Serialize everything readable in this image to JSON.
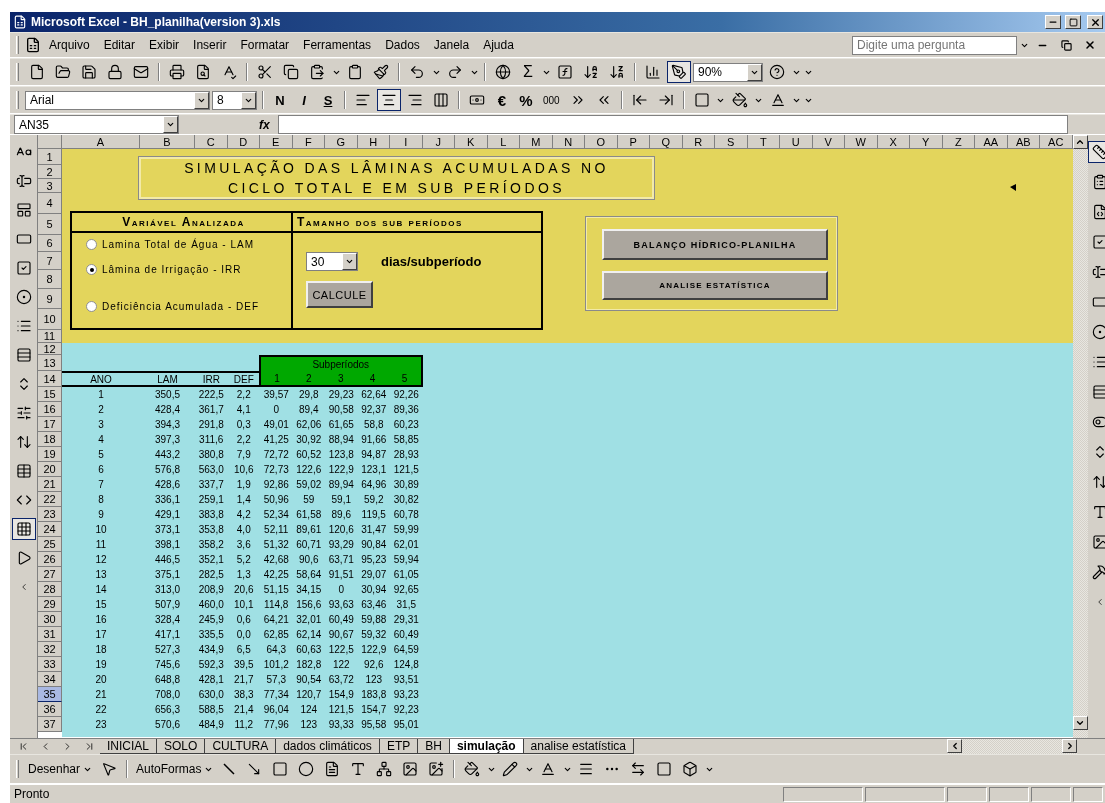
{
  "window": {
    "title": "Microsoft Excel - BH_planilha(version 3).xls"
  },
  "menu": [
    "Arquivo",
    "Editar",
    "Exibir",
    "Inserir",
    "Formatar",
    "Ferramentas",
    "Dados",
    "Janela",
    "Ajuda"
  ],
  "help_box": {
    "placeholder": "Digite uma pergunta"
  },
  "standard_toolbar": {
    "sum": "Σ",
    "zoom": "90%",
    "drawing_pressed": true
  },
  "formatting_toolbar": {
    "font": "Arial",
    "size": "8",
    "bold": "N",
    "italic": "I",
    "underline": "S",
    "align_left": false,
    "align_center": true,
    "align_right": false,
    "euro": "€",
    "percent": "%",
    "thousands": "000"
  },
  "formula_bar": {
    "name_box": "AN35",
    "function_label": "fx"
  },
  "forms_toolbar": {
    "grid_pressed": true
  },
  "control_toolbox": {
    "design_mode": true
  },
  "columns": [
    "A",
    "B",
    "C",
    "D",
    "E",
    "F",
    "G",
    "H",
    "I",
    "J",
    "K",
    "L",
    "M",
    "N",
    "O",
    "P",
    "Q",
    "R",
    "S",
    "T",
    "U",
    "V",
    "W",
    "X",
    "Y",
    "Z",
    "AA",
    "AB",
    "AC"
  ],
  "rows": [
    {
      "label": "1",
      "selected": false
    },
    {
      "label": "2",
      "selected": false
    },
    {
      "label": "3",
      "selected": false
    },
    {
      "label": "4",
      "selected": false
    },
    {
      "label": "5",
      "selected": false
    },
    {
      "label": "6",
      "selected": false
    },
    {
      "label": "7",
      "selected": false
    },
    {
      "label": "8",
      "selected": false
    },
    {
      "label": "9",
      "selected": false
    },
    {
      "label": "10",
      "selected": false
    },
    {
      "label": "11",
      "selected": false
    },
    {
      "label": "12",
      "selected": false
    },
    {
      "label": "13",
      "selected": false
    },
    {
      "label": "14",
      "selected": false
    },
    {
      "label": "15",
      "selected": false
    },
    {
      "label": "16",
      "selected": false
    },
    {
      "label": "17",
      "selected": false
    },
    {
      "label": "18",
      "selected": false
    },
    {
      "label": "19",
      "selected": false
    },
    {
      "label": "20",
      "selected": false
    },
    {
      "label": "21",
      "selected": false
    },
    {
      "label": "22",
      "selected": false
    },
    {
      "label": "23",
      "selected": false
    },
    {
      "label": "24",
      "selected": false
    },
    {
      "label": "25",
      "selected": false
    },
    {
      "label": "26",
      "selected": false
    },
    {
      "label": "27",
      "selected": false
    },
    {
      "label": "28",
      "selected": false
    },
    {
      "label": "29",
      "selected": false
    },
    {
      "label": "30",
      "selected": false
    },
    {
      "label": "31",
      "selected": false
    },
    {
      "label": "32",
      "selected": false
    },
    {
      "label": "33",
      "selected": false
    },
    {
      "label": "34",
      "selected": false
    },
    {
      "label": "35",
      "selected": true
    },
    {
      "label": "36",
      "selected": false
    },
    {
      "label": "37",
      "selected": false
    }
  ],
  "sheet": {
    "title": [
      "SIMULAÇÃO DAS LÂMINAS ACUMULADAS NO",
      "CICLO TOTAL E EM SUB PERÍODOS"
    ],
    "variable_panel": {
      "heading": "Variável Analizada",
      "options": [
        {
          "label": "Lamina Total de Água - LAM",
          "selected": false
        },
        {
          "label": "Lâmina de Irrigação - IRR",
          "selected": true
        },
        {
          "label": "Deficiência Acumulada - DEF",
          "selected": false
        }
      ]
    },
    "period_panel": {
      "heading": "Tamanho dos sub períodos",
      "period": "30",
      "unit": "dias/subperíodo",
      "button": "CALCULE"
    },
    "nav_buttons": [
      "BALANÇO HÍDRICO-PLANILHA",
      "ANALISE ESTATÍSTICA"
    ],
    "table": {
      "group_header": "Subperíodos",
      "columns": [
        "ANO",
        "LAM",
        "IRR",
        "DEF",
        "1",
        "2",
        "3",
        "4",
        "5"
      ],
      "rows": [
        [
          "1",
          "350,5",
          "222,5",
          "2,2",
          "39,57",
          "29,8",
          "29,23",
          "62,64",
          "92,26"
        ],
        [
          "2",
          "428,4",
          "361,7",
          "4,1",
          "0",
          "89,4",
          "90,58",
          "92,37",
          "89,36"
        ],
        [
          "3",
          "394,3",
          "291,8",
          "0,3",
          "49,01",
          "62,06",
          "61,65",
          "58,8",
          "60,23"
        ],
        [
          "4",
          "397,3",
          "311,6",
          "2,2",
          "41,25",
          "30,92",
          "88,94",
          "91,66",
          "58,85"
        ],
        [
          "5",
          "443,2",
          "380,8",
          "7,9",
          "72,72",
          "60,52",
          "123,8",
          "94,87",
          "28,93"
        ],
        [
          "6",
          "576,8",
          "563,0",
          "10,6",
          "72,73",
          "122,6",
          "122,9",
          "123,1",
          "121,5"
        ],
        [
          "7",
          "428,6",
          "337,7",
          "1,9",
          "92,86",
          "59,02",
          "89,94",
          "64,96",
          "30,89"
        ],
        [
          "8",
          "336,1",
          "259,1",
          "1,4",
          "50,96",
          "59",
          "59,1",
          "59,2",
          "30,82"
        ],
        [
          "9",
          "429,1",
          "383,8",
          "4,2",
          "52,34",
          "61,58",
          "89,6",
          "119,5",
          "60,78"
        ],
        [
          "10",
          "373,1",
          "353,8",
          "4,0",
          "52,11",
          "89,61",
          "120,6",
          "31,47",
          "59,99"
        ],
        [
          "11",
          "398,1",
          "358,2",
          "3,6",
          "51,32",
          "60,71",
          "93,29",
          "90,84",
          "62,01"
        ],
        [
          "12",
          "446,5",
          "352,1",
          "5,2",
          "42,68",
          "90,6",
          "63,71",
          "95,23",
          "59,94"
        ],
        [
          "13",
          "375,1",
          "282,5",
          "1,3",
          "42,25",
          "58,64",
          "91,51",
          "29,07",
          "61,05"
        ],
        [
          "14",
          "313,0",
          "208,9",
          "20,6",
          "51,15",
          "34,15",
          "0",
          "30,94",
          "92,65"
        ],
        [
          "15",
          "507,9",
          "460,0",
          "10,1",
          "114,8",
          "156,6",
          "93,63",
          "63,46",
          "31,5"
        ],
        [
          "16",
          "328,4",
          "245,9",
          "0,6",
          "64,21",
          "32,01",
          "60,49",
          "59,88",
          "29,31"
        ],
        [
          "17",
          "417,1",
          "335,5",
          "0,0",
          "62,85",
          "62,14",
          "90,67",
          "59,32",
          "60,49"
        ],
        [
          "18",
          "527,3",
          "434,9",
          "6,5",
          "64,3",
          "60,63",
          "122,5",
          "122,9",
          "64,59"
        ],
        [
          "19",
          "745,6",
          "592,3",
          "39,5",
          "101,2",
          "182,8",
          "122",
          "92,6",
          "124,8"
        ],
        [
          "20",
          "648,8",
          "428,1",
          "21,7",
          "57,3",
          "90,54",
          "63,72",
          "123",
          "93,51"
        ],
        [
          "21",
          "708,0",
          "630,0",
          "38,3",
          "77,34",
          "120,7",
          "154,9",
          "183,8",
          "93,23"
        ],
        [
          "22",
          "656,3",
          "588,5",
          "21,4",
          "96,04",
          "124",
          "121,5",
          "154,7",
          "92,23"
        ],
        [
          "23",
          "570,6",
          "484,9",
          "11,2",
          "77,96",
          "123",
          "93,33",
          "95,58",
          "95,01"
        ]
      ]
    }
  },
  "sheet_tabs": [
    {
      "label": "INICIAL",
      "selected": false
    },
    {
      "label": "SOLO",
      "selected": false
    },
    {
      "label": "CULTURA",
      "selected": false
    },
    {
      "label": "dados climáticos",
      "selected": false
    },
    {
      "label": "ETP",
      "selected": false
    },
    {
      "label": "BH",
      "selected": false
    },
    {
      "label": "simulação",
      "selected": true
    },
    {
      "label": "analise estatística",
      "selected": false
    }
  ],
  "drawing_toolbar": {
    "draw_menu": "Desenhar",
    "autoshapes_menu": "AutoFormas"
  },
  "status_bar": {
    "text": "Pronto"
  }
}
